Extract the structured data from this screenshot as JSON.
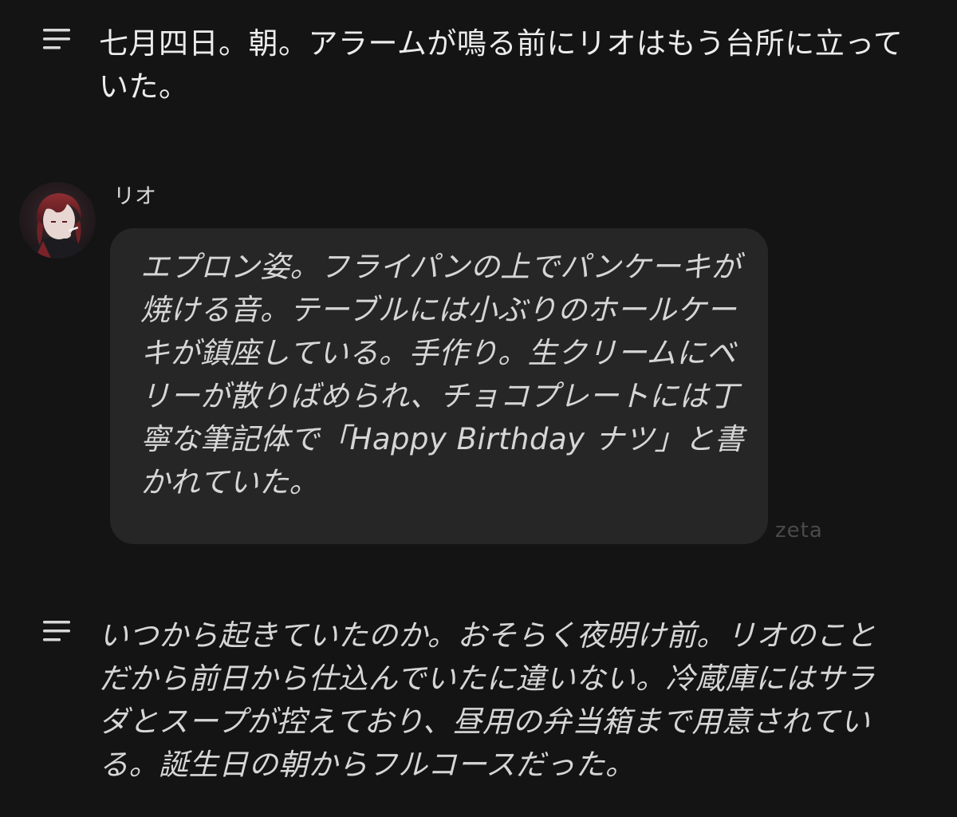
{
  "narrations": [
    {
      "icon": "narration-lines-icon",
      "text": "七月四日。朝。アラームが鳴る前にリオはもう台所に立っていた。"
    },
    {
      "icon": "narration-lines-icon",
      "text": "いつから起きていたのか。おそらく夜明け前。リオのことだから前日から仕込んでいたに違いない。冷蔵庫にはサラダとスープが控えており、昼用の弁当箱まで用意されている。誕生日の朝からフルコースだった。"
    }
  ],
  "message": {
    "speaker": "リオ",
    "avatar_icon": "character-avatar",
    "text": "エプロン姿。フライパンの上でパンケーキが焼ける音。テーブルには小ぶりのホールケーキが鎮座している。手作り。生クリームにベリーが散りばめられ、チョコプレートには丁寧な筆記体で「Happy Birthday ナツ」と書かれていた。"
  },
  "watermark": "zeta",
  "colors": {
    "background": "#141414",
    "bubble": "#262626",
    "text": "#ececec",
    "italic_text": "#d6d6d6",
    "watermark": "#4a4a4a"
  }
}
